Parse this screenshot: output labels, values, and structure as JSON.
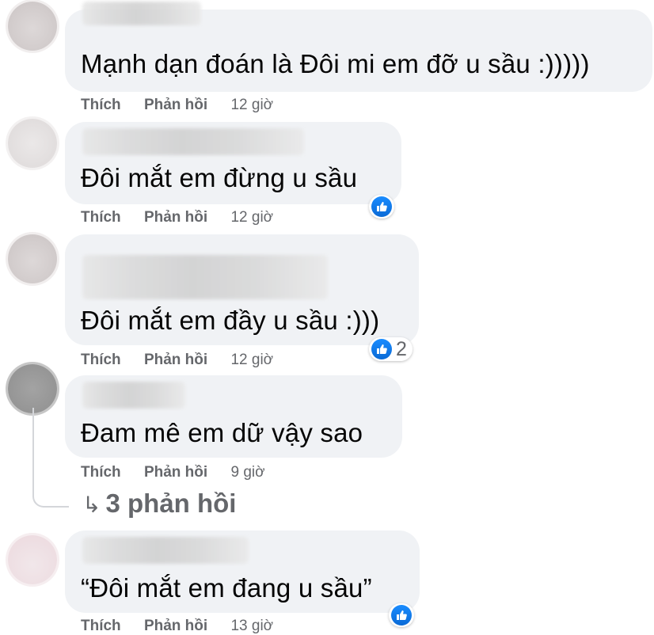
{
  "actions": {
    "like": "Thích",
    "reply": "Phản hồi"
  },
  "comments": [
    {
      "text": "Mạnh dạn đoán là Đôi mi em đỡ u sầu :)))))",
      "time": "12 giờ",
      "reaction_count": ""
    },
    {
      "text": "Đôi mắt em đừng u sầu",
      "time": "12 giờ",
      "reaction_count": ""
    },
    {
      "text": "Đôi mắt em đầy u sầu :)))",
      "time": "12 giờ",
      "reaction_count": "2"
    },
    {
      "text": "Đam mê em dữ vậy sao",
      "time": "9 giờ",
      "reaction_count": ""
    },
    {
      "text": "“Đôi mắt em đang u sầu”",
      "time": "13 giờ",
      "reaction_count": ""
    }
  ],
  "replies": {
    "arrow": "↳",
    "label": "3 phản hồi"
  },
  "icons": {
    "reaction": "like-thumb-icon"
  },
  "colors": {
    "bubble": "#f0f2f5",
    "meta_text": "#65676b",
    "like_blue": "#1877f2"
  }
}
